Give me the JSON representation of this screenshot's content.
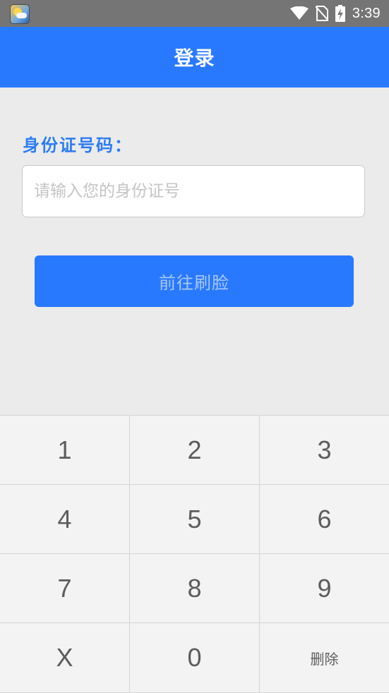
{
  "status_bar": {
    "time": "3:39"
  },
  "app_bar": {
    "title": "登录"
  },
  "form": {
    "id_label": "身份证号码：",
    "id_input": {
      "value": "",
      "placeholder": "请输入您的身份证号"
    },
    "submit_label": "前往刷脸"
  },
  "keypad": {
    "keys": [
      "1",
      "2",
      "3",
      "4",
      "5",
      "6",
      "7",
      "8",
      "9",
      "X",
      "0",
      "删除"
    ]
  },
  "colors": {
    "primary": "#2979ff",
    "label": "#2b7cf5",
    "background": "#ebebeb"
  }
}
